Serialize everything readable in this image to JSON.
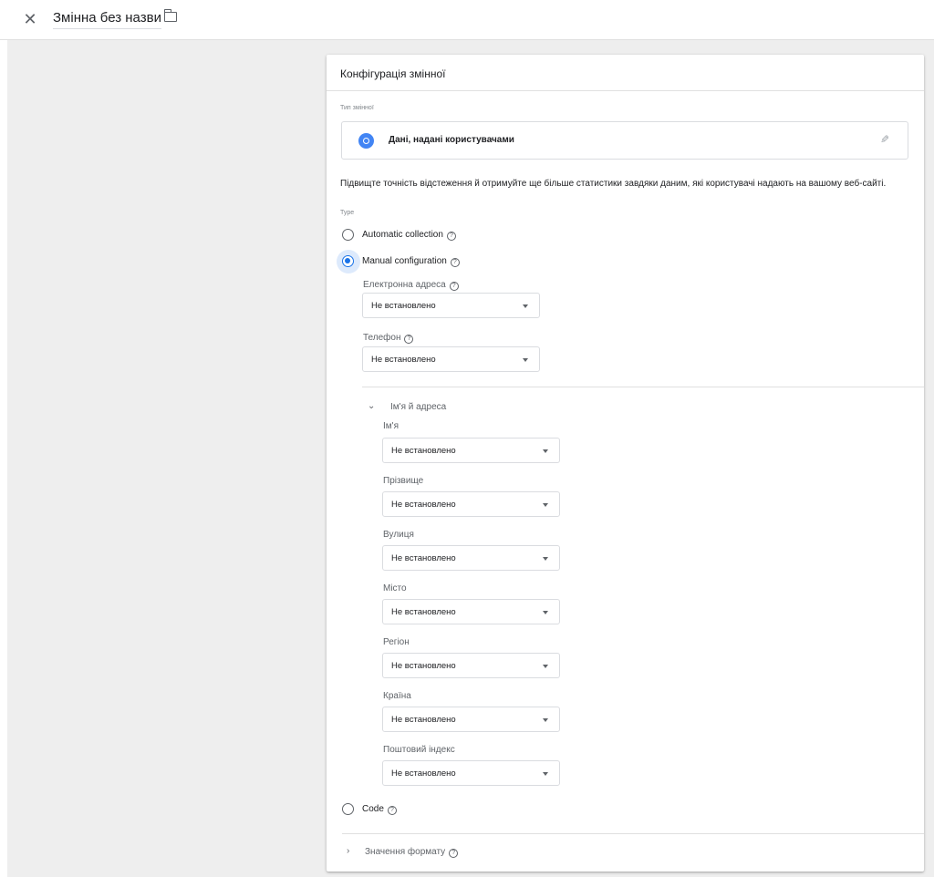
{
  "header": {
    "close_icon": "close-icon",
    "title": "Змінна без назви",
    "folder_icon": "folder-icon"
  },
  "card": {
    "title": "Конфігурація змінної",
    "variable_type_label": "Тип змінної",
    "variable_type_name": "Дані, надані користувачами",
    "description": "Підвищте точність відстеження й отримуйте ще більше статистики завдяки даним, які користувачі надають на вашому веб-сайті.",
    "type_caption": "Type",
    "options": {
      "automatic": "Automatic collection",
      "manual": "Manual configuration",
      "code": "Code"
    },
    "selected_option": "manual",
    "help_glyph": "?",
    "fields": {
      "email": {
        "label": "Електронна адреса",
        "value": "Не встановлено"
      },
      "phone": {
        "label": "Телефон",
        "value": "Не встановлено"
      }
    },
    "name_address": {
      "label": "Ім'я й адреса",
      "fields": [
        {
          "label": "Ім'я",
          "value": "Не встановлено"
        },
        {
          "label": "Прізвище",
          "value": "Не встановлено"
        },
        {
          "label": "Вулиця",
          "value": "Не встановлено"
        },
        {
          "label": "Місто",
          "value": "Не встановлено"
        },
        {
          "label": "Регіон",
          "value": "Не встановлено"
        },
        {
          "label": "Країна",
          "value": "Не встановлено"
        },
        {
          "label": "Поштовий індекс",
          "value": "Не встановлено"
        }
      ]
    },
    "format_section": "Значення формату"
  },
  "colors": {
    "accent": "#1a73e8",
    "type_icon": "#4285f4",
    "background": "#eeeeee"
  }
}
